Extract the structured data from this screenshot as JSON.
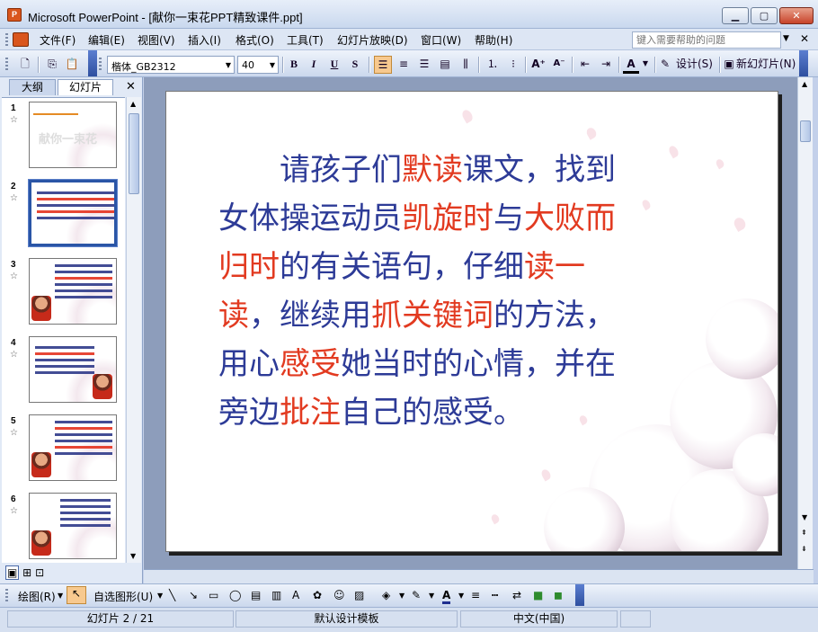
{
  "window": {
    "title": "Microsoft PowerPoint - [献你一束花PPT精致课件.ppt]",
    "app_icon_label": "P"
  },
  "menu": {
    "items": [
      "文件(F)",
      "编辑(E)",
      "视图(V)",
      "插入(I)",
      "格式(O)",
      "工具(T)",
      "幻灯片放映(D)",
      "窗口(W)",
      "帮助(H)"
    ],
    "help_placeholder": "键入需要帮助的问题"
  },
  "toolbar": {
    "font_name": "楷体_GB2312",
    "font_size": "40",
    "bold": "B",
    "italic": "I",
    "underline": "U",
    "shadow": "S",
    "font_color": "A",
    "design_label": "设计(S)",
    "new_slide_label": "新幻灯片(N)"
  },
  "left_pane": {
    "tabs": [
      "大纲",
      "幻灯片"
    ],
    "thumbnails": [
      {
        "number": "1",
        "title": "献你一束花"
      },
      {
        "number": "2"
      },
      {
        "number": "3"
      },
      {
        "number": "4"
      },
      {
        "number": "5"
      },
      {
        "number": "6"
      }
    ],
    "active_index": 1
  },
  "slide": {
    "lines": [
      [
        {
          "t": "　　请孩子们",
          "hl": false
        },
        {
          "t": "默读",
          "hl": true
        },
        {
          "t": "课文，找到",
          "hl": false
        }
      ],
      [
        {
          "t": "女体操运动员",
          "hl": false
        },
        {
          "t": "凯旋时",
          "hl": true
        },
        {
          "t": "与",
          "hl": false
        },
        {
          "t": "大败而",
          "hl": true
        }
      ],
      [
        {
          "t": "归时",
          "hl": true
        },
        {
          "t": "的有关语句，仔细",
          "hl": false
        },
        {
          "t": "读一",
          "hl": true
        }
      ],
      [
        {
          "t": "读",
          "hl": true
        },
        {
          "t": "，继续用",
          "hl": false
        },
        {
          "t": "抓关键词",
          "hl": true
        },
        {
          "t": "的方法，",
          "hl": false
        }
      ],
      [
        {
          "t": "用心",
          "hl": false
        },
        {
          "t": "感受",
          "hl": true
        },
        {
          "t": "她当时的心情，并在",
          "hl": false
        }
      ],
      [
        {
          "t": "旁边",
          "hl": false
        },
        {
          "t": "批注",
          "hl": true
        },
        {
          "t": "自己的感受。",
          "hl": false
        }
      ]
    ],
    "text_color": "#2d3b97",
    "highlight_color": "#e23a20"
  },
  "drawing_toolbar": {
    "draw_label": "绘图(R)",
    "autoshapes_label": "自选图形(U)"
  },
  "status": {
    "slide_info": "幻灯片 2 / 21",
    "template": "默认设计模板",
    "language": "中文(中国)"
  }
}
